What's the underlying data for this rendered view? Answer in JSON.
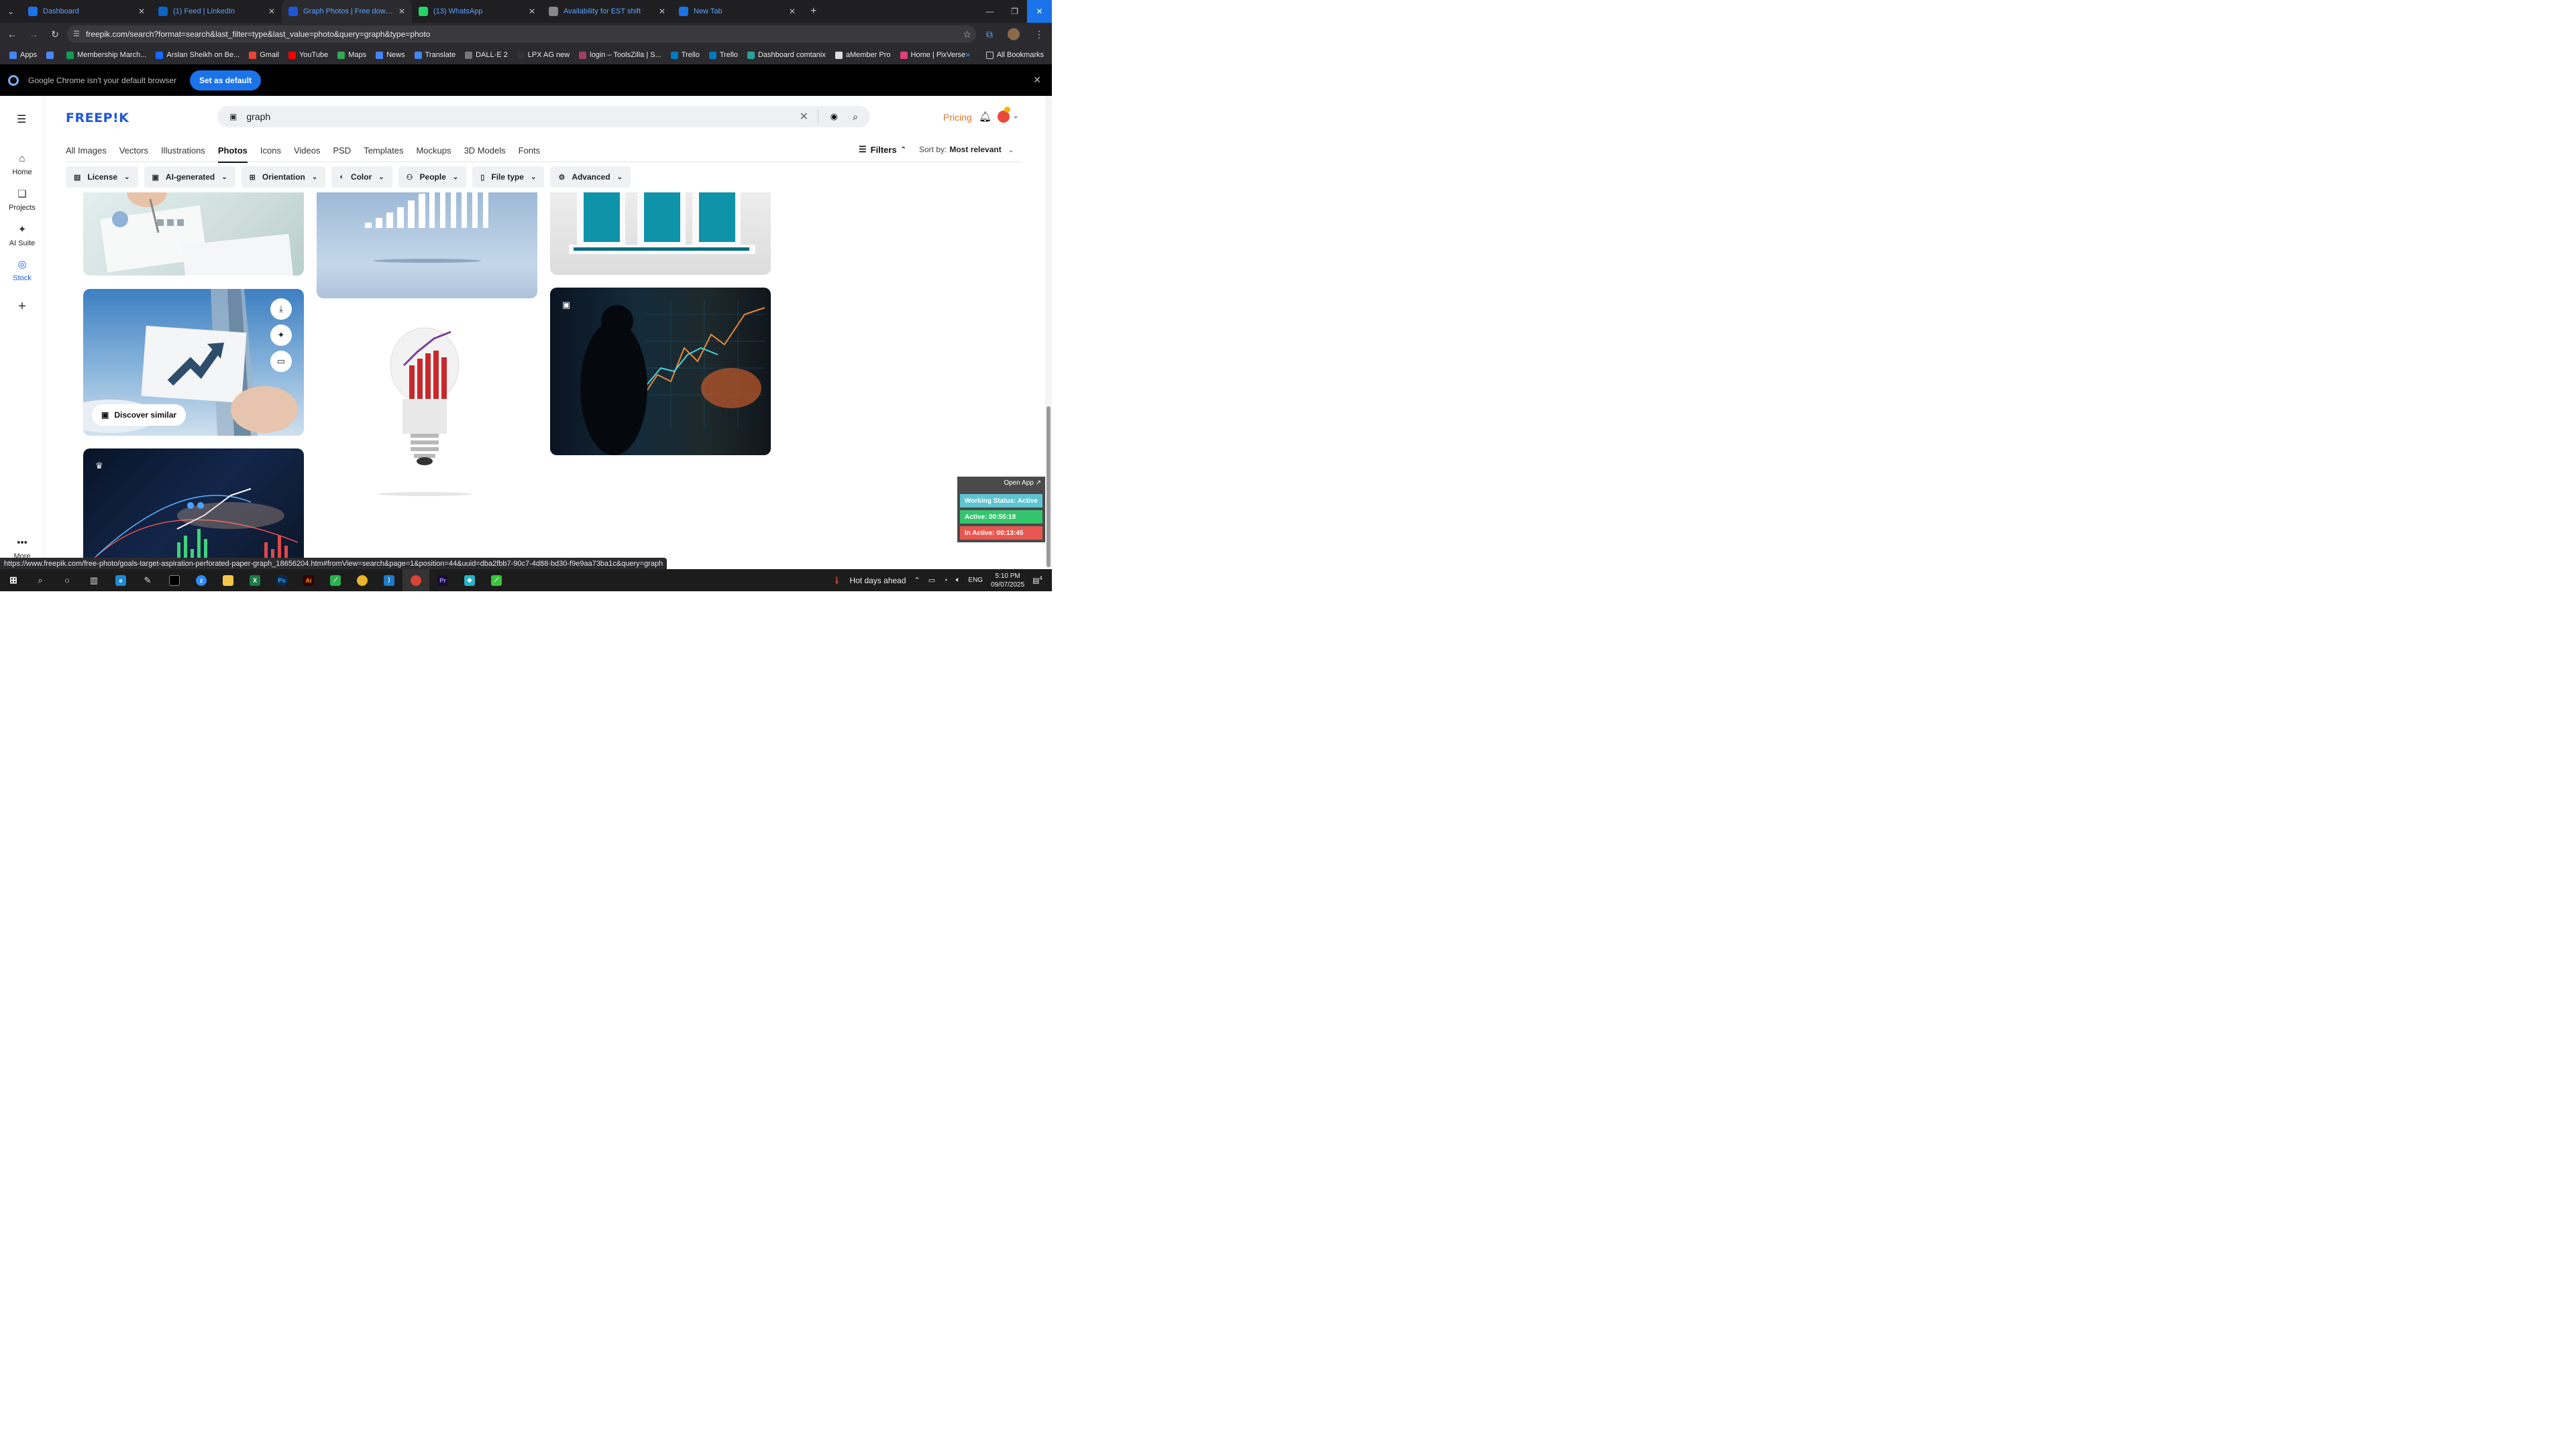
{
  "tabs": [
    {
      "title": "Dashboard",
      "fav_color": "#1a73e8",
      "active": false
    },
    {
      "title": "(1) Feed | LinkedIn",
      "fav_color": "#0a66c2",
      "active": false
    },
    {
      "title": "Graph Photos | Free download",
      "fav_color": "#1d56d6",
      "active": true
    },
    {
      "title": "(13) WhatsApp",
      "fav_color": "#25d366",
      "active": false
    },
    {
      "title": "Availability for EST shift",
      "fav_color": "#888888",
      "active": false
    },
    {
      "title": "New Tab",
      "fav_color": "#1a73e8",
      "active": false
    }
  ],
  "omnibox": {
    "url": "freepik.com/search?format=search&last_filter=type&last_value=photo&query=graph&type=photo"
  },
  "bookmarks": [
    {
      "label": "Apps",
      "color": "#4285f4"
    },
    {
      "label": "",
      "color": "#4a8af4"
    },
    {
      "label": "Membership March...",
      "color": "#0f9d58"
    },
    {
      "label": "Arslan Sheikh on Be...",
      "color": "#1769ff"
    },
    {
      "label": "Gmail",
      "color": "#ea4335"
    },
    {
      "label": "YouTube",
      "color": "#ff0000"
    },
    {
      "label": "Maps",
      "color": "#34a853"
    },
    {
      "label": "News",
      "color": "#4285f4"
    },
    {
      "label": "Translate",
      "color": "#4285f4"
    },
    {
      "label": "DALL·E 2",
      "color": "#777777"
    },
    {
      "label": "LPX AG new",
      "color": "#333333"
    },
    {
      "label": "login – ToolsZilla | S...",
      "color": "#a04060"
    },
    {
      "label": "Trello",
      "color": "#0079bf"
    },
    {
      "label": "Trello",
      "color": "#0079bf"
    },
    {
      "label": "Dashboard comtanix",
      "color": "#2aa198"
    },
    {
      "label": "aMember Pro",
      "color": "#dddddd"
    },
    {
      "label": "Home | PixVerse",
      "color": "#e0407a"
    }
  ],
  "all_bookmarks": "All Bookmarks",
  "infobar": {
    "message": "Google Chrome isn't your default browser",
    "button": "Set as default"
  },
  "rail": {
    "items": [
      {
        "label": "Home",
        "icon": "⌂"
      },
      {
        "label": "Projects",
        "icon": "❏"
      },
      {
        "label": "AI Suite",
        "icon": "✦"
      },
      {
        "label": "Stock",
        "icon": "◎"
      }
    ],
    "more": "More"
  },
  "header": {
    "logo": "FREEP!K",
    "search_query": "graph",
    "pricing": "Pricing"
  },
  "types": [
    "All Images",
    "Vectors",
    "Illustrations",
    "Photos",
    "Icons",
    "Videos",
    "PSD",
    "Templates",
    "Mockups",
    "3D Models",
    "Fonts"
  ],
  "active_type": "Photos",
  "filters_label": "Filters",
  "sort": {
    "label": "Sort by:",
    "value": "Most relevant"
  },
  "chips": [
    {
      "label": "License",
      "icon": "▤"
    },
    {
      "label": "AI-generated",
      "icon": "▣"
    },
    {
      "label": "Orientation",
      "icon": "⊞"
    },
    {
      "label": "Color",
      "icon": "◐"
    },
    {
      "label": "People",
      "icon": "⚇"
    },
    {
      "label": "File type",
      "icon": "▯"
    },
    {
      "label": "Advanced",
      "icon": "⚙"
    }
  ],
  "discover_similar": "Discover similar",
  "status_url": "https://www.freepik.com/free-photo/goals-target-aspiration-perforated-paper-graph_18656204.htm#fromView=search&page=1&position=44&uuid=dba2fbb7-90c7-4d88-bd30-f9e9aa73ba1c&query=graph",
  "widget": {
    "open_app": "Open App ↗",
    "working": "Working Status: Active",
    "active": "Active: 00:55:18",
    "inactive": "In Active: 00:13:45"
  },
  "taskbar": {
    "weather": "Hot days ahead",
    "lang": "ENG",
    "time": "5:10 PM",
    "date": "09/07/2025",
    "notif": "4"
  }
}
